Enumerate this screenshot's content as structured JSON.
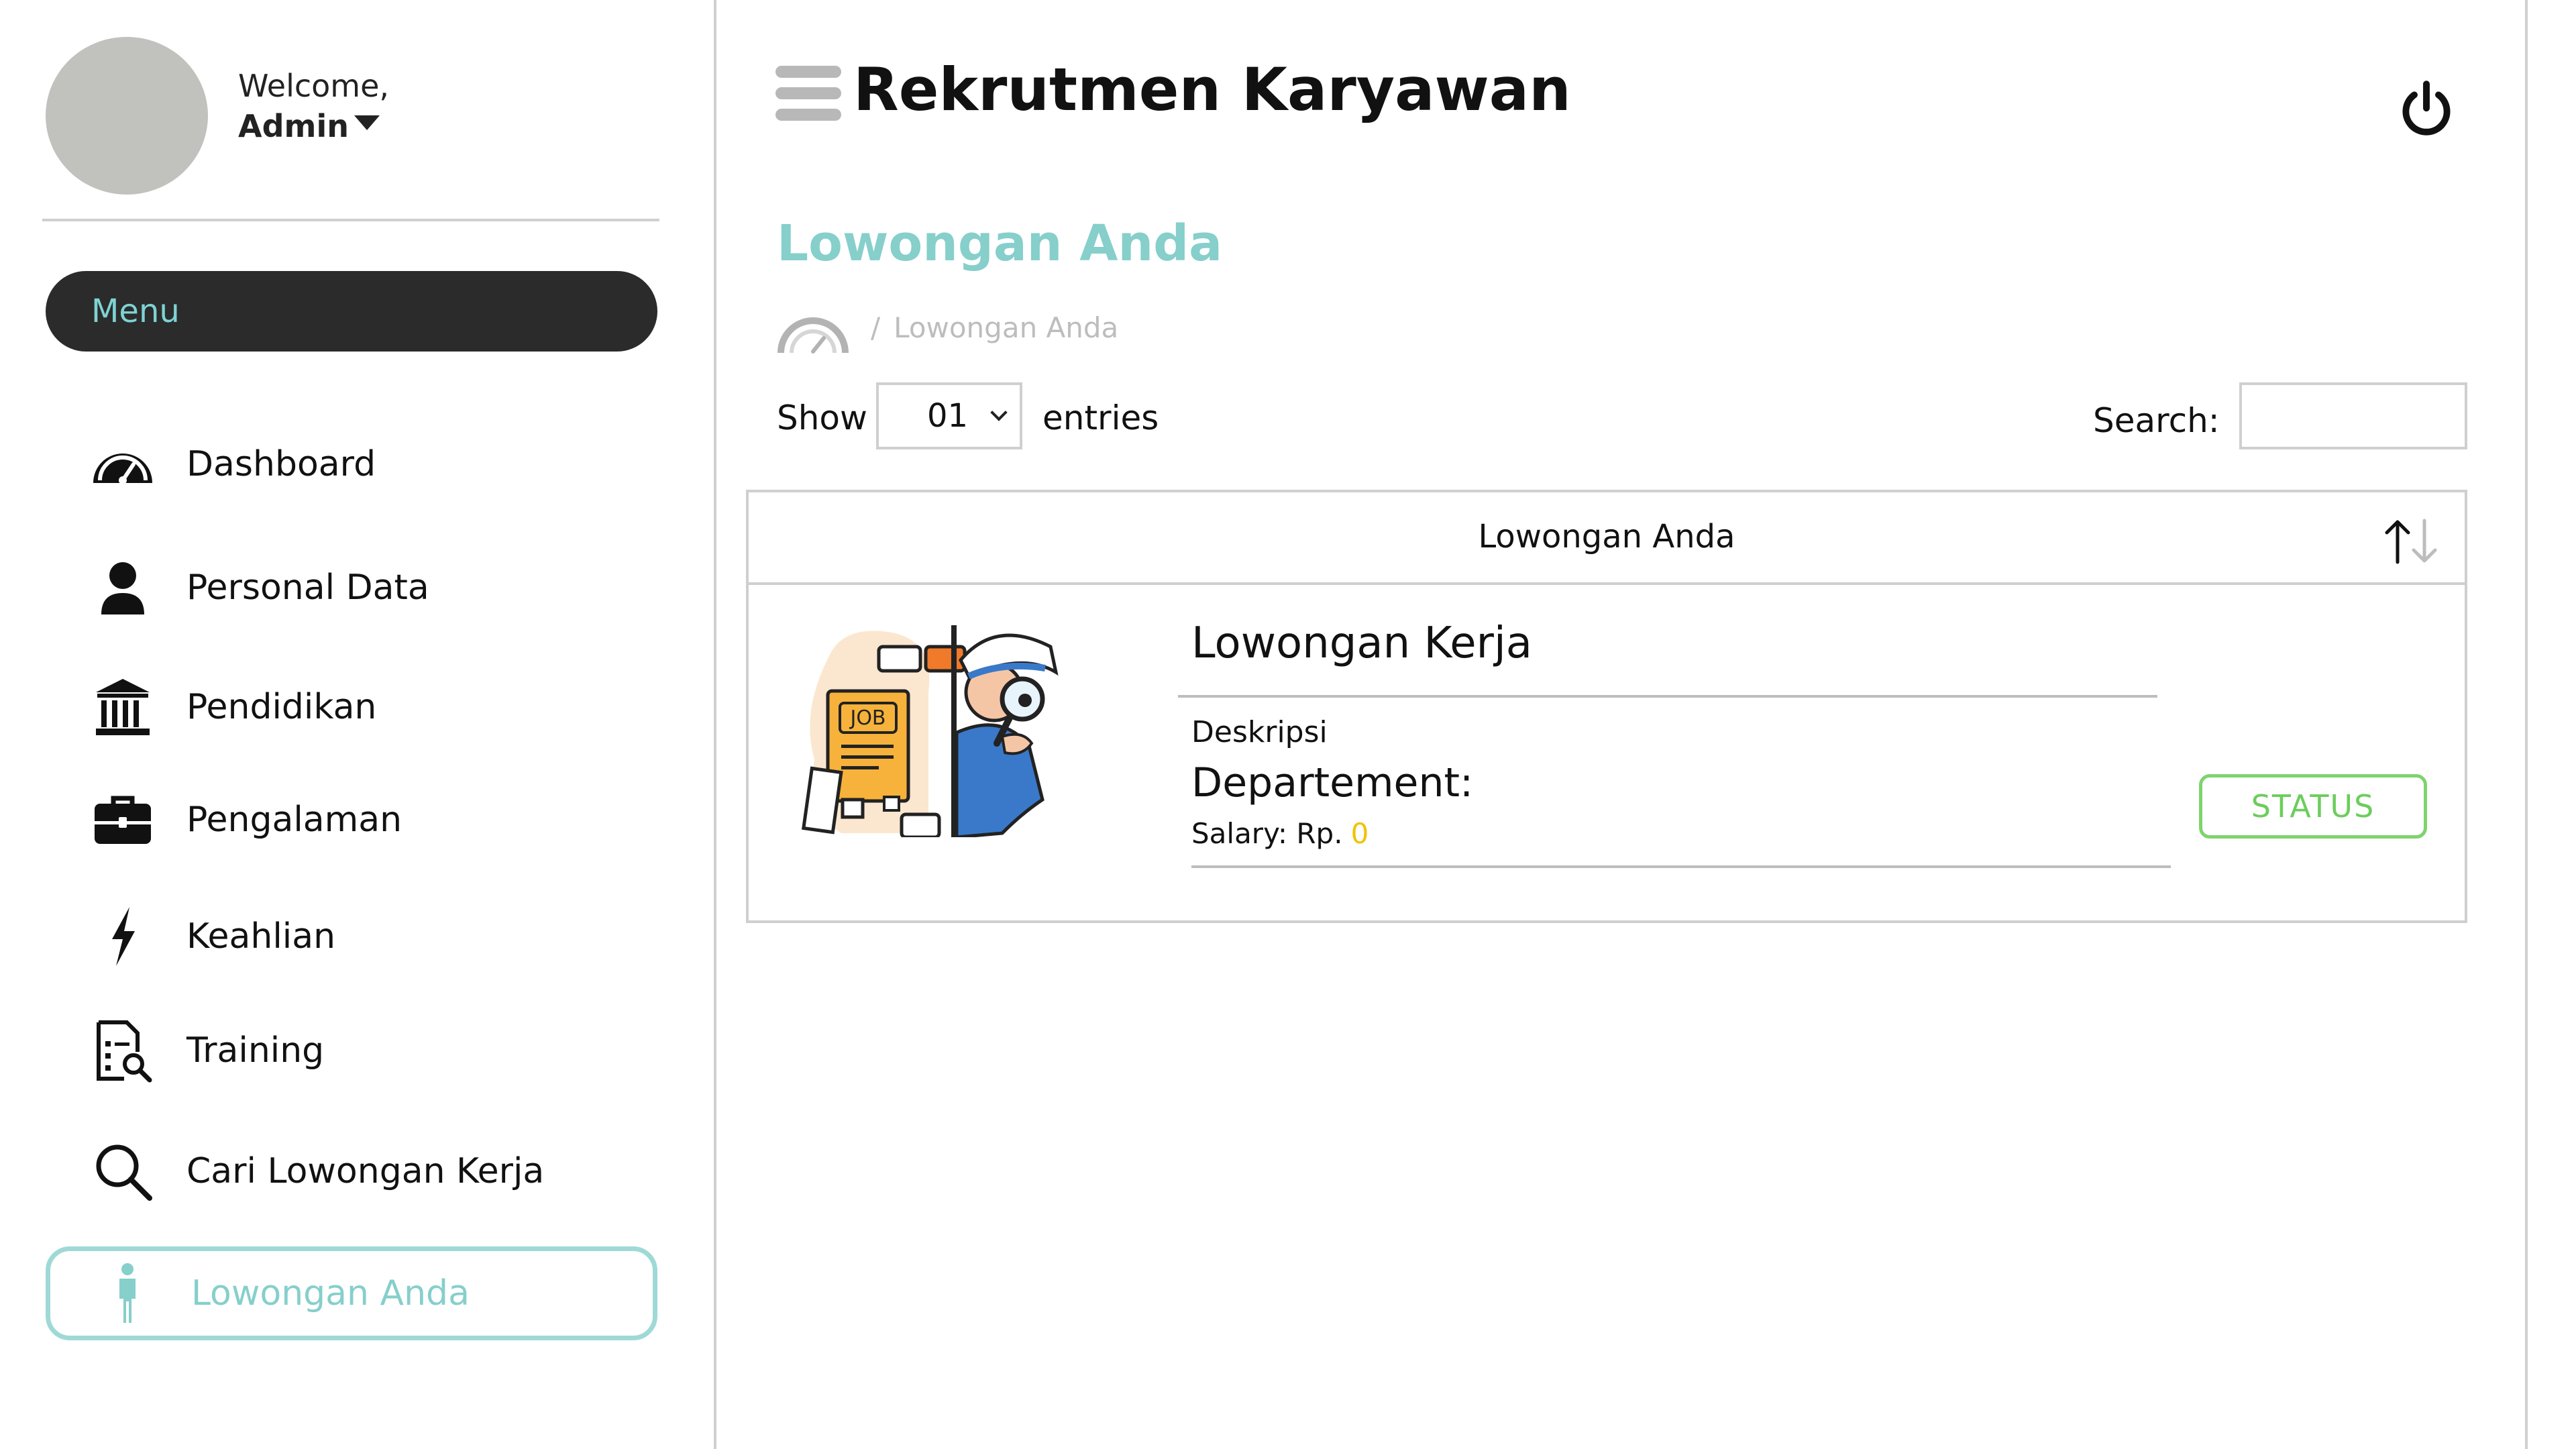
{
  "user": {
    "welcome": "Welcome,",
    "name": "Admin"
  },
  "sidebar": {
    "menu_label": "Menu",
    "items": [
      {
        "label": "Dashboard",
        "icon": "dashboard-gauge-icon"
      },
      {
        "label": "Personal Data",
        "icon": "person-icon"
      },
      {
        "label": "Pendidikan",
        "icon": "institution-icon"
      },
      {
        "label": "Pengalaman",
        "icon": "briefcase-icon"
      },
      {
        "label": "Keahlian",
        "icon": "lightning-icon"
      },
      {
        "label": "Training",
        "icon": "document-search-icon"
      },
      {
        "label": "Cari Lowongan Kerja",
        "icon": "search-icon"
      },
      {
        "label": "Lowongan Anda",
        "icon": "person-standing-icon",
        "active": true
      }
    ]
  },
  "header": {
    "title": "Rekrutmen Karyawan"
  },
  "page": {
    "title": "Lowongan Anda",
    "breadcrumb": {
      "separator": "/",
      "current": "Lowongan Anda"
    }
  },
  "controls": {
    "show_label": "Show",
    "entries_value": "01",
    "entries_label": "entries",
    "search_label": "Search:",
    "search_value": ""
  },
  "table": {
    "header": "Lowongan Anda",
    "rows": [
      {
        "title": "Lowongan Kerja",
        "illustration_label": "JOB",
        "description_label": "Deskripsi",
        "department_label": "Departement:",
        "salary_label": "Salary: Rp.",
        "salary_value": "0",
        "status_label": "STATUS"
      }
    ]
  },
  "colors": {
    "accent_teal": "#86cfcb",
    "menu_bg": "#2b2b2b",
    "status_green": "#6ccd5c",
    "salary_yellow": "#f2c200",
    "border_gray": "#cfcfcf"
  }
}
